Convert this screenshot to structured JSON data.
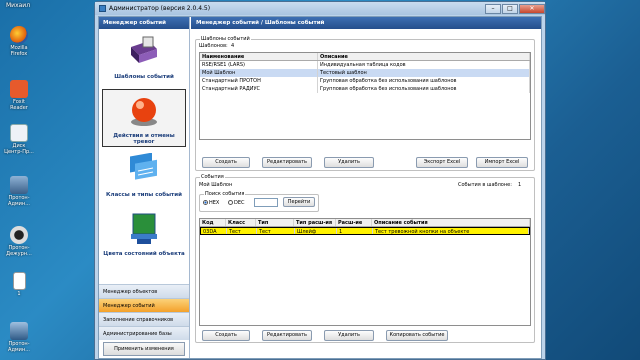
{
  "desktop": {
    "user": "Михаил",
    "icons": [
      {
        "label": "Mozilla Firefox"
      },
      {
        "label": "Foxit Reader"
      },
      {
        "label": "Диск Центр-Пр..."
      },
      {
        "label": "Протон-Админ..."
      },
      {
        "label": "Протон-Дежурн..."
      },
      {
        "label": "1"
      },
      {
        "label": "Протон-Админ..."
      }
    ]
  },
  "window": {
    "title": "Администратор (версия 2.0.4.5)",
    "min": "–",
    "max": "□",
    "close": "✕"
  },
  "leftpanel": {
    "header": "Менеджер событий",
    "items": [
      {
        "label": "Шаблоны событий"
      },
      {
        "label": "Действия и отмены тревог"
      },
      {
        "label": "Классы и типы событий"
      },
      {
        "label": "Цвета состояний объекта"
      }
    ],
    "nav": [
      {
        "label": "Менеджер объектов"
      },
      {
        "label": "Менеджер событий"
      },
      {
        "label": "Заполнение справочников"
      },
      {
        "label": "Администрирование базы"
      }
    ],
    "apply": "Применить изменения"
  },
  "main": {
    "header": "Менеджер событий / Шаблоны событий",
    "templates": {
      "group_title": "Шаблоны событий",
      "count_label": "Шаблонов:",
      "count": "4",
      "columns": [
        "Наименование",
        "Описание"
      ],
      "rows": [
        [
          "RSE/RSE1 (LARS)",
          "Индивидуальная таблица кодов"
        ],
        [
          "Мой Шаблон",
          "Тестовый шаблон"
        ],
        [
          "Стандартный ПРОТОН",
          "Групповая обработка без использования шаблонов"
        ],
        [
          "Стандартный РАДИУС",
          "Групповая обработка без использования шаблонов"
        ]
      ],
      "buttons": {
        "create": "Создать",
        "edit": "Редактировать",
        "delete": "Удалить",
        "export": "Экспорт Excel",
        "import": "Импорт Excel"
      }
    },
    "events": {
      "group_title": "События",
      "template_name": "Мой Шаблон",
      "events_count_label": "События в шаблоне:",
      "events_count": "1",
      "search_title": "Поиск события",
      "hex": "HEX",
      "dec": "DEC",
      "go": "Перейти",
      "columns": [
        "Код",
        "Класс",
        "Тип",
        "Тип расш-ия",
        "Расш-ие",
        "Описание события"
      ],
      "rows": [
        [
          "03DA",
          "Тест",
          "Тест",
          "Шлейф",
          "1",
          "Тест тревожной кнопки на объекте"
        ]
      ],
      "buttons": {
        "create": "Создать",
        "edit": "Редактировать",
        "delete": "Удалить",
        "copy": "Копировать событие"
      }
    }
  }
}
